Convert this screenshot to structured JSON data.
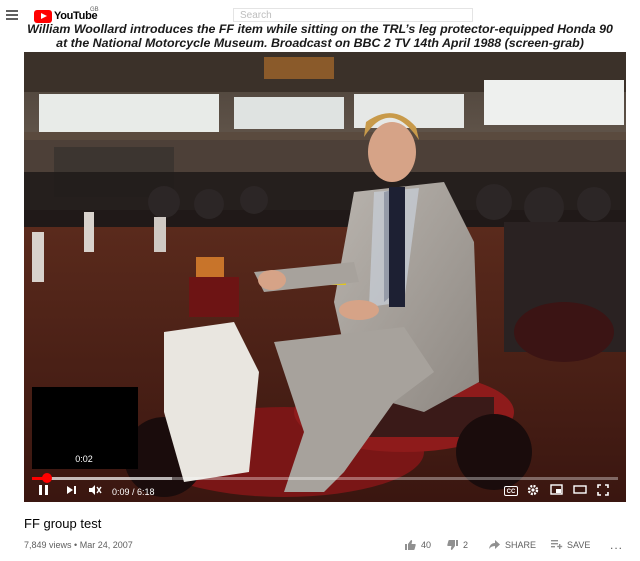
{
  "header": {
    "menu_icon": "hamburger-menu-icon",
    "logo_text": "YouTube",
    "logo_country": "GB",
    "search_placeholder": "Search"
  },
  "caption": {
    "line1": "William Woollard introduces the FF item while sitting on the TRL’s leg protector-equipped Honda 90",
    "line2": "at the National Motorcycle Museum. Broadcast  on BBC 2 TV 14th April 1988 (screen-grab)"
  },
  "player": {
    "preview_time": "0:02",
    "current_time": "0:09",
    "duration": "6:18",
    "time_display": "0:09 / 6:18",
    "progress_fraction": 0.024,
    "cc_label": "CC",
    "icons": [
      "pause-icon",
      "next-icon",
      "mute-icon",
      "cc-icon",
      "settings-icon",
      "miniplayer-icon",
      "theater-icon",
      "fullscreen-icon"
    ]
  },
  "video": {
    "title": "FF group test",
    "views": "7,849 views",
    "separator": "•",
    "date": "Mar 24, 2007"
  },
  "actions": {
    "likes": "40",
    "dislikes": "2",
    "share_label": "SHARE",
    "save_label": "SAVE",
    "more_label": "..."
  },
  "colors": {
    "brand_red": "#ff0000",
    "text_primary": "#030303",
    "text_secondary": "#606060"
  }
}
